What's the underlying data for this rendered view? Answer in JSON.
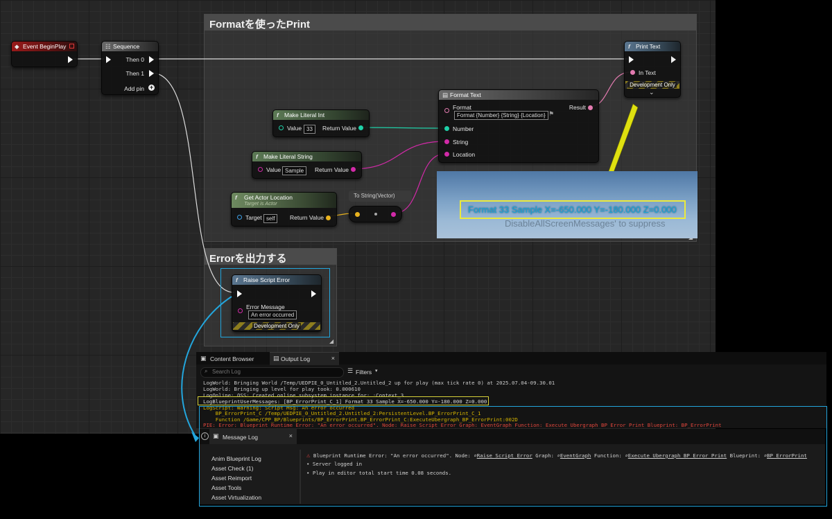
{
  "comments": {
    "format": "Formatを使ったPrint",
    "error": "Errorを出力する"
  },
  "nodes": {
    "begin_play": {
      "title": "Event BeginPlay"
    },
    "sequence": {
      "title": "Sequence",
      "then0": "Then 0",
      "then1": "Then 1",
      "add_pin": "Add pin"
    },
    "print_text": {
      "title": "Print Text",
      "in_text": "In Text",
      "dev_only": "Development Only"
    },
    "format_text": {
      "title": "Format Text",
      "format_label": "Format",
      "format_value": "Format {Number} {String} {Location}",
      "result": "Result",
      "number": "Number",
      "string": "String",
      "location": "Location"
    },
    "literal_int": {
      "title": "Make Literal Int",
      "value_label": "Value",
      "value": "33",
      "return": "Return Value"
    },
    "literal_string": {
      "title": "Make Literal String",
      "value_label": "Value",
      "value": "Sample",
      "return": "Return Value"
    },
    "actor_location": {
      "title": "Get Actor Location",
      "subtitle": "Target is Actor",
      "target_label": "Target",
      "target_value": "self",
      "return": "Return Value"
    },
    "to_string": {
      "title": "To String(Vector)"
    },
    "raise_error": {
      "title": "Raise Script Error",
      "msg_label": "Error Message",
      "msg_value": "An error occurred",
      "dev_only": "Development Only"
    }
  },
  "screenshot": {
    "printed": "Format 33 Sample X=-650.000 Y=-180.000 Z=0.000",
    "ghost": "DisableAllScreenMessages' to suppress"
  },
  "output_log": {
    "tabs": [
      "Content Browser",
      "Output Log"
    ],
    "search_placeholder": "Search Log",
    "filters": "Filters",
    "lines": [
      {
        "text": "LogWorld: Bringing World /Temp/UEDPIE_0_Untitled_2.Untitled_2 up for play (max tick rate 0) at 2025.07.04-09.30.01",
        "color": "#c8c8c8"
      },
      {
        "text": "LogWorld: Bringing up level for play took: 0.000610",
        "color": "#c8c8c8"
      },
      {
        "text": "LogOnline: OSS: Created online subsystem instance for: :Context_3",
        "color": "#c8c8c8"
      },
      {
        "text": "LogBlueprintUserMessages: [BP_ErrorPrint_C_1] Format 33 Sample X=-650.000 Y=-180.000 Z=0.000",
        "color": "#d8d8d8"
      },
      {
        "text": "LogScript: Warning: Script Msg: An error occurred",
        "color": "#d6b400"
      },
      {
        "text": "    BP_ErrorPrint_C /Temp/UEDPIE_0_Untitled_2.Untitled_2:PersistentLevel.BP_ErrorPrint_C_1",
        "color": "#d6b400"
      },
      {
        "text": "    Function /Game/CPP_BP/Blueprints/BP_ErrorPrint.BP_ErrorPrint_C:ExecuteUbergraph_BP_ErrorPrint:002D",
        "color": "#d6b400"
      },
      {
        "text": "PIE: Error: Blueprint Runtime Error: \"An error occurred\". Node:  Raise Script Error Graph:  EventGraph Function:  Execute Ubergraph BP Error Print Blueprint:  BP_ErrorPrint",
        "color": "#e0463c"
      }
    ]
  },
  "message_log": {
    "tab": "Message Log",
    "categories": [
      "Anim Blueprint Log",
      "Asset Check (1)",
      "Asset Reimport",
      "Asset Tools",
      "Asset Virtualization"
    ],
    "error_prefix": "Blueprint Runtime Error: \"An error occurred\". Node:",
    "node_link": "Raise Script Error",
    "graph_label": "Graph:",
    "graph_link": "EventGraph",
    "function_label": "Function:",
    "function_link": "Execute Ubergraph BP Error Print",
    "blueprint_label": "Blueprint:",
    "blueprint_link": "BP_ErrorPrint",
    "bullets": [
      "Server logged in",
      "Play in editor total start time 0.08 seconds."
    ]
  }
}
